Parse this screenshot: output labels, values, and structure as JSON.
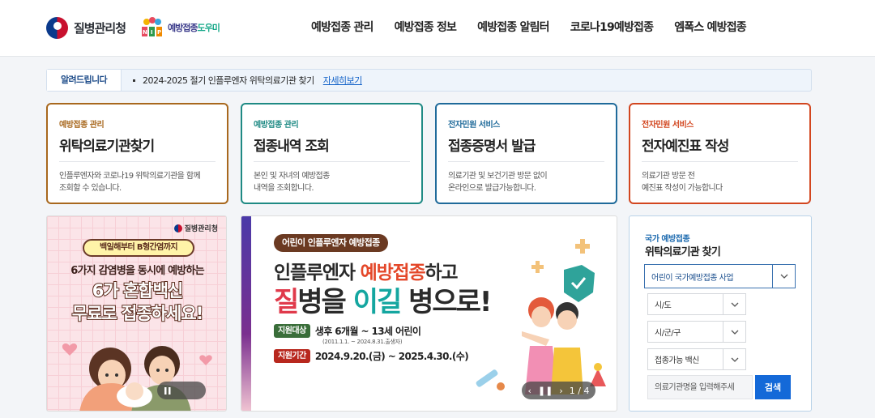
{
  "header": {
    "kdca_logo_text": "질병관리청",
    "service_logo": {
      "mark": "NIP",
      "text_main": "예방접종",
      "text_accent": "도우미"
    },
    "nav": [
      "예방접종 관리",
      "예방접종 정보",
      "예방접종 알림터",
      "코로나19예방접종",
      "엠폭스 예방접종"
    ]
  },
  "notice": {
    "label": "알려드립니다",
    "text": "2024-2025 절기 인플루엔자 위탁의료기관 찾기",
    "link": "자세히보기"
  },
  "cards": [
    {
      "category": "예방접종 관리",
      "title": "위탁의료기관찾기",
      "desc": "인플루엔자와 코로나19 위탁의료기관을 함께\n조회할 수 있습니다.",
      "color": "#a8681e"
    },
    {
      "category": "예방접종 관리",
      "title": "접종내역 조회",
      "desc": "본인 및 자녀의 예방접종\n내역을 조회합니다.",
      "color": "#1f8a84"
    },
    {
      "category": "전자민원 서비스",
      "title": "접종증명서 발급",
      "desc": "의료기관 및 보건기관 방문 없이\n온라인으로 발급가능합니다.",
      "color": "#1f6a9a"
    },
    {
      "category": "전자민원 서비스",
      "title": "전자예진표 작성",
      "desc": "의료기관 방문 전\n예진표 작성이 가능합니다",
      "color": "#d2461f"
    }
  ],
  "banner_left": {
    "logo": "질병관리청",
    "pill": "백일해부터 B형간염까지",
    "line1": "6가지 감염병을 동시에 예방하는",
    "line2": "6가 혼합백신",
    "line3": "무료로 접종하세요!"
  },
  "banner_center": {
    "tag": "어린이 인플루엔자 예방접종",
    "title_a": "인플루엔자 ",
    "title_hl": "예방접종",
    "title_b": "하고",
    "title2_1": "질",
    "title2_2": "병을 ",
    "title2_3": "이길",
    "title2_4": " 병으로!",
    "target_label": "지원대상",
    "target_value": "생후 6개월 ~ 13세 어린이",
    "target_note": "(2011.1.1. ~ 2024.8.31.출생자)",
    "period_label": "지원기간",
    "period_value": "2024.9.20.(금) ~ 2025.4.30.(수)",
    "pager": "1 / 4"
  },
  "search_panel": {
    "subtitle": "국가 예방접종",
    "title": "위탁의료기관 찾기",
    "program_select": "어린이 국가예방접종 사업",
    "province_select": "시/도",
    "district_select": "시/군/구",
    "vaccine_select": "접종가능 백신",
    "input_placeholder": "의료기관명을 입력해주세",
    "search_button": "검색"
  }
}
